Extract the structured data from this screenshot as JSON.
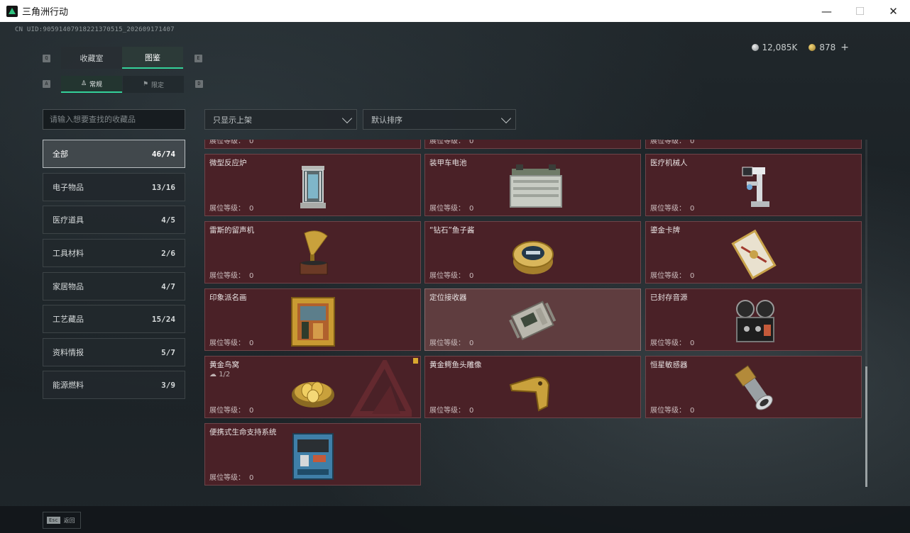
{
  "window": {
    "title": "三角洲行动",
    "minimize": "—",
    "maximize": "☐",
    "close": "✕"
  },
  "uid": "CN UID:9059140791822137051​5_202609171407",
  "currency": {
    "silver": "12,085K",
    "gold": "878",
    "add": "+"
  },
  "keyhints": {
    "q": "Q",
    "e": "E",
    "a": "A",
    "d": "D"
  },
  "tabs": {
    "main": [
      {
        "label": "收藏室"
      },
      {
        "label": "图鉴"
      }
    ],
    "sub": [
      {
        "label": "常规",
        "icon": "♙"
      },
      {
        "label": "限定",
        "icon": "⚑"
      }
    ]
  },
  "search": {
    "placeholder": "请输入想要查找的收藏品"
  },
  "filters": {
    "show": "只显示上架",
    "sort": "默认排序"
  },
  "categories": [
    {
      "label": "全部",
      "count": "46/74"
    },
    {
      "label": "电子物品",
      "count": "13/16"
    },
    {
      "label": "医疗道具",
      "count": "4/5"
    },
    {
      "label": "工具材料",
      "count": "2/6"
    },
    {
      "label": "家居物品",
      "count": "4/7"
    },
    {
      "label": "工艺藏品",
      "count": "15/24"
    },
    {
      "label": "资料情报",
      "count": "5/7"
    },
    {
      "label": "能源燃料",
      "count": "3/9"
    }
  ],
  "level_label": "展位等级：",
  "items": [
    {
      "name": "",
      "level": "0"
    },
    {
      "name": "",
      "level": "0"
    },
    {
      "name": "",
      "level": "0"
    },
    {
      "name": "微型反应炉",
      "level": "0",
      "icon": "reactor-icon"
    },
    {
      "name": "装甲车电池",
      "level": "0",
      "icon": "battery-icon"
    },
    {
      "name": "医疗机械人",
      "level": "0",
      "icon": "medical-robot-icon"
    },
    {
      "name": "雷斯的留声机",
      "level": "0",
      "icon": "gramophone-icon"
    },
    {
      "name": "“钻石”鱼子酱",
      "level": "0",
      "icon": "caviar-icon"
    },
    {
      "name": "鎏金卡牌",
      "level": "0",
      "icon": "card-icon"
    },
    {
      "name": "印象派名画",
      "level": "0",
      "icon": "painting-icon"
    },
    {
      "name": "定位接收器",
      "level": "0",
      "icon": "receiver-icon"
    },
    {
      "name": "已封存音源",
      "level": "0",
      "icon": "tape-recorder-icon"
    },
    {
      "name": "黄金鸟窝",
      "level": "0",
      "icon": "golden-nest-icon",
      "sub": "1/2"
    },
    {
      "name": "黄金鳄鱼头雕像",
      "level": "0",
      "icon": "croc-statue-icon"
    },
    {
      "name": "恒星敏感器",
      "level": "0",
      "icon": "star-sensor-icon"
    },
    {
      "name": "便携式生命支持系统",
      "level": "0",
      "icon": "life-support-icon"
    }
  ],
  "bottom": {
    "esc_key": "Esc",
    "esc_label": "返回"
  },
  "colors": {
    "accent": "#34d19a",
    "card_bg": "#4a2127",
    "badge": "#d9a92f"
  }
}
